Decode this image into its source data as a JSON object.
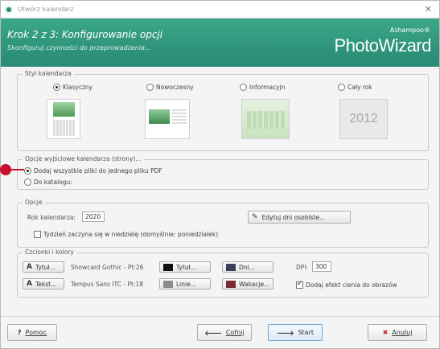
{
  "window": {
    "title": "Utwórz kalendarz"
  },
  "header": {
    "step_title": "Krok 2 z 3: Konfigurowanie opcji",
    "step_subtitle": "Skonfiguruj czynności do przeprowadzenia...",
    "brand_small": "Ashampoo®",
    "brand_big": "PhotoWizard"
  },
  "style_group": {
    "legend": "Styl kalendarza",
    "options": [
      {
        "label": "Klasyczny",
        "selected": true
      },
      {
        "label": "Nowoczesny",
        "selected": false
      },
      {
        "label": "Informacyjn",
        "selected": false
      },
      {
        "label": "Cały rok",
        "selected": false
      }
    ],
    "year_thumb_text": "2012"
  },
  "output_group": {
    "legend": "Opcje wyjściowe kalendarza (strony)...",
    "options": [
      {
        "label": "Dodaj wszystkie pliki do jednego pliku PDF",
        "selected": true
      },
      {
        "label": "Do katalogu:",
        "selected": false
      }
    ]
  },
  "options_group": {
    "legend": "Opcje",
    "year_label": "Rok kalendarza:",
    "year_value": "2020",
    "edit_days_button": "Edytuj dni osobiste...",
    "week_sunday_label": "Tydzień zaczyna się w niedzielę (domyślnie: poniedziałek)",
    "week_sunday_checked": false
  },
  "fonts_group": {
    "legend": "Czcionki i kolory",
    "title_font_button": "Tytuł...",
    "title_font_value": "Showcard Gothic - Pt:26",
    "text_font_button": "Tekst...",
    "text_font_value": "Tempus Sans ITC - Pt:18",
    "color_title_button": "Tytuł...",
    "color_lines_button": "Linie...",
    "color_days_button": "Dni...",
    "color_holidays_button": "Wakacje...",
    "colors": {
      "title": "#111111",
      "lines": "#8c8c8c",
      "days": "#3b3f5c",
      "holidays": "#7a2a35"
    },
    "dpi_label": "DPI:",
    "dpi_value": "300",
    "shadow_label": "Dodaj efekt cienia do obrazów",
    "shadow_checked": true
  },
  "footer": {
    "help": "Pomoc",
    "back": "Cofnij",
    "start": "Start",
    "cancel": "Anuluj"
  },
  "accent_color": "#2f947b",
  "marker_color": "#c8102e"
}
